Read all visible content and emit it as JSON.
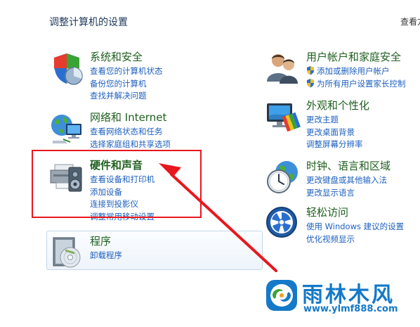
{
  "page_title": "调整计算机的设置",
  "view_by": "查看方",
  "categories": {
    "system_security": {
      "title": "系统和安全",
      "icon": "shield-icon",
      "links": [
        "查看您的计算机状态",
        "备份您的计算机",
        "查找并解决问题"
      ]
    },
    "network": {
      "title": "网络和 Internet",
      "icon": "network-globe-icon",
      "links": [
        "查看网络状态和任务",
        "选择家庭组和共享选项"
      ]
    },
    "hardware_sound": {
      "title": "硬件和声音",
      "icon": "printer-speaker-icon",
      "links": [
        "查看设备和打印机",
        "添加设备",
        "连接到投影仪",
        "调整常用移动设置"
      ]
    },
    "programs": {
      "title": "程序",
      "icon": "program-disc-icon",
      "links": [
        "卸载程序"
      ]
    },
    "user_accounts": {
      "title": "用户帐户和家庭安全",
      "icon": "users-icon",
      "links": [
        "添加或删除用户帐户",
        "为所有用户设置家长控制"
      ]
    },
    "appearance": {
      "title": "外观和个性化",
      "icon": "monitor-palette-icon",
      "links": [
        "更改主题",
        "更改桌面背景",
        "调整屏幕分辨率"
      ]
    },
    "clock_region": {
      "title": "时钟、语言和区域",
      "icon": "clock-globe-icon",
      "links": [
        "更改键盘或其他输入法",
        "更改显示语言"
      ]
    },
    "ease_of_access": {
      "title": "轻松访问",
      "icon": "ease-of-access-icon",
      "links": [
        "使用 Windows 建议的设置",
        "优化视频显示"
      ]
    }
  },
  "annotation": {
    "color": "#e8171e"
  },
  "watermark": {
    "name": "雨林木风",
    "url": "www.ylmf888.com",
    "color": "#1479c8"
  },
  "colors": {
    "title_green": "#1e5f1e",
    "link_blue": "#1c5fbf",
    "heading_navy": "#1e395b"
  }
}
